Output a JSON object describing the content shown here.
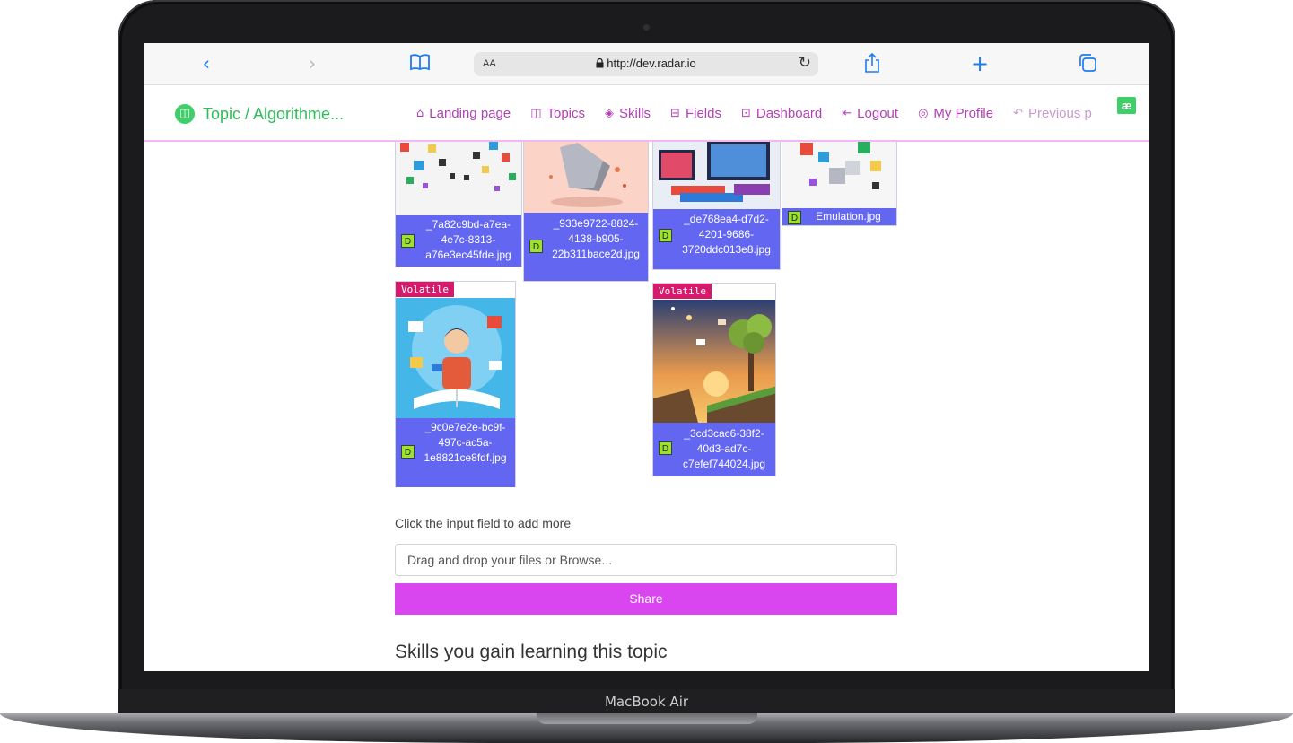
{
  "device": {
    "label": "MacBook Air"
  },
  "browser": {
    "aa_label": "AA",
    "url": "http://dev.radar.io",
    "icons": {
      "back": "chevron-left-icon",
      "forward": "chevron-right-icon",
      "bookmarks": "book-icon",
      "reload": "reload-icon",
      "share": "share-icon",
      "new_tab": "plus-icon",
      "tabs": "tabs-icon"
    }
  },
  "site_nav": {
    "brand_title": "Topic / Algorithme...",
    "links": [
      {
        "label": "Landing page",
        "icon": "home-icon"
      },
      {
        "label": "Topics",
        "icon": "book-open-icon"
      },
      {
        "label": "Skills",
        "icon": "graduation-cap-icon"
      },
      {
        "label": "Fields",
        "icon": "briefcase-icon"
      },
      {
        "label": "Dashboard",
        "icon": "dashboard-icon"
      },
      {
        "label": "Logout",
        "icon": "logout-icon"
      },
      {
        "label": "My Profile",
        "icon": "user-circle-icon"
      },
      {
        "label": "Previous p",
        "icon": "undo-icon"
      }
    ],
    "badge": "æ"
  },
  "files": [
    {
      "name": "_7a82c9bd-a7ea-4e7c-8313-a76e3ec45fde.jpg",
      "badge": "D"
    },
    {
      "name": "_933e9722-8824-4138-b905-22b311bace2d.jpg",
      "badge": "D"
    },
    {
      "name": "_de768ea4-d7d2-4201-9686-3720ddc013e8.jpg",
      "badge": "D"
    },
    {
      "name": "Emulation.jpg",
      "badge": "D"
    },
    {
      "name": "_9c0e7e2e-bc9f-497c-ac5a-1e8821ce8fdf.jpg",
      "badge": "D",
      "tag": "Volatile"
    },
    {
      "name": "_3cd3cac6-38f2-40d3-ad7c-c7efef744024.jpg",
      "badge": "D",
      "tag": "Volatile"
    }
  ],
  "upload": {
    "hint": "Click the input field to add more",
    "placeholder": "Drag and drop your files or Browse...",
    "share_label": "Share"
  },
  "skills_heading": "Skills you gain learning this topic",
  "colors": {
    "card": "#6366f1",
    "share": "#d946ef",
    "volatile": "#d61a6b",
    "brand": "#2ebd59",
    "nav_link": "#b43fb8"
  }
}
